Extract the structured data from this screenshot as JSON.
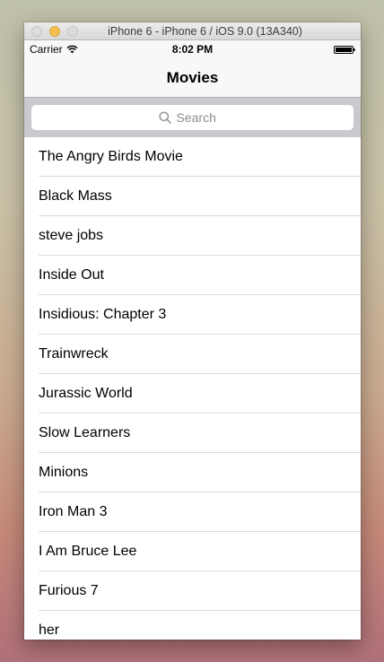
{
  "window": {
    "title": "iPhone 6 - iPhone 6 / iOS 9.0 (13A340)"
  },
  "status_bar": {
    "carrier": "Carrier",
    "time": "8:02 PM",
    "icons": [
      "wifi-icon",
      "battery-icon"
    ]
  },
  "nav": {
    "title": "Movies"
  },
  "search": {
    "placeholder": "Search",
    "icon": "search-icon"
  },
  "movies": [
    "The Angry Birds Movie",
    "Black Mass",
    "steve jobs",
    "Inside Out",
    "Insidious: Chapter 3",
    "Trainwreck",
    "Jurassic World",
    "Slow Learners",
    "Minions",
    "Iron Man 3",
    "I Am Bruce Lee",
    "Furious 7",
    "her"
  ],
  "colors": {
    "traffic_minimize": "#f5bf4f",
    "search_bar_background": "#c9c9ce",
    "nav_background": "#f8f8f8"
  }
}
